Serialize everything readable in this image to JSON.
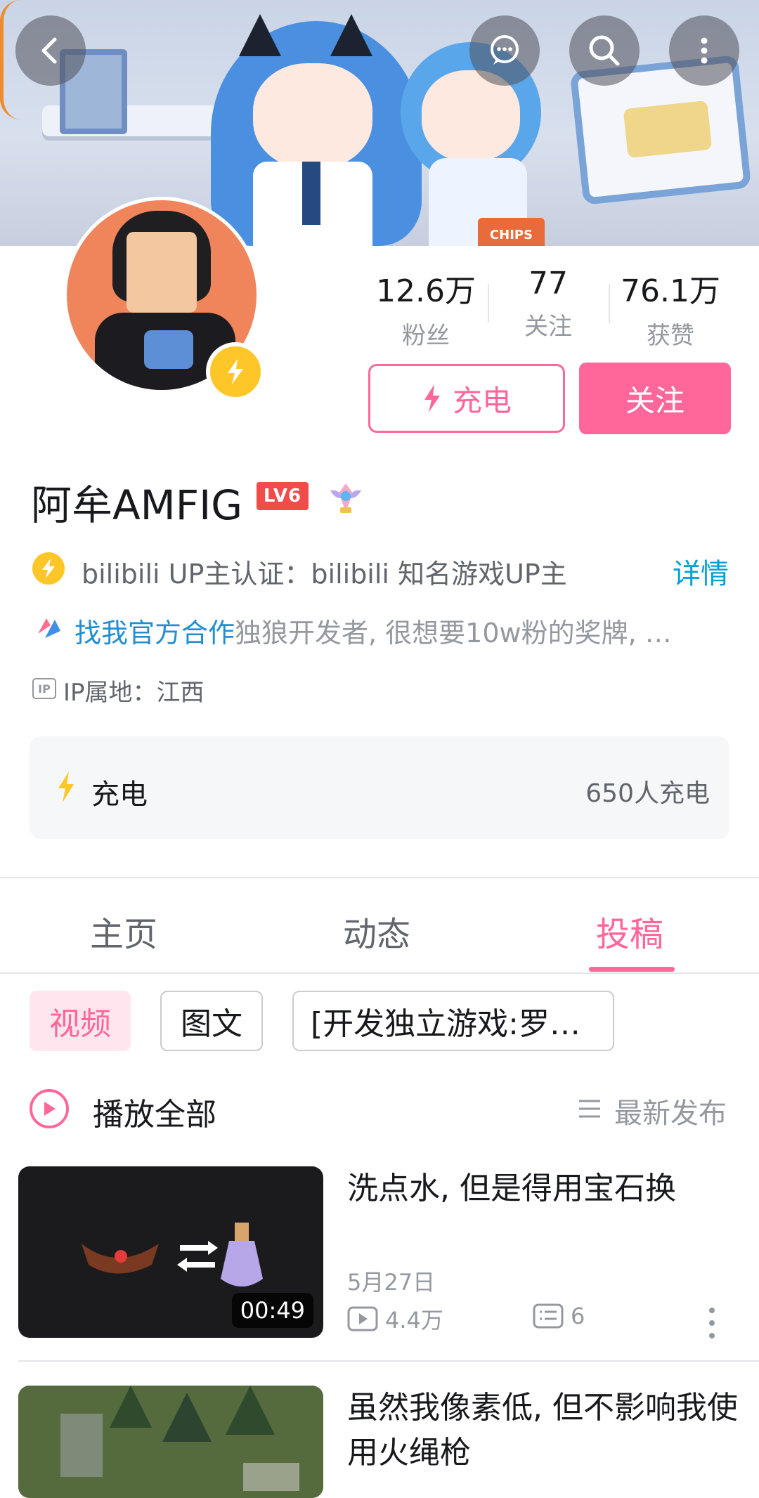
{
  "profile": {
    "name": "阿牟AMFIG",
    "level": "LV6",
    "verification": "bilibili UP主认证：bilibili 知名游戏UP主",
    "detail_link": "详情",
    "coop_link": "找我官方合作",
    "bio": "独狼开发者, 很想要10w粉的奖牌, …",
    "ip_location": "IP属地：江西"
  },
  "stats": [
    {
      "value": "12.6万",
      "label": "粉丝"
    },
    {
      "value": "77",
      "label": "关注"
    },
    {
      "value": "76.1万",
      "label": "获赞"
    }
  ],
  "actions": {
    "charge": "充电",
    "follow": "关注"
  },
  "charge_card": {
    "title": "充电",
    "count": "650人充电"
  },
  "tabs": [
    "主页",
    "动态",
    "投稿"
  ],
  "active_tab": "投稿",
  "filters": [
    "视频",
    "图文",
    "[开发独立游戏:罗…"
  ],
  "play_all": "播放全部",
  "sort": "最新发布",
  "banner_text": {
    "chips": "CHIPS"
  },
  "videos": [
    {
      "title": "洗点水, 但是得用宝石换",
      "duration": "00:49",
      "date": "5月27日",
      "views": "4.4万",
      "comments": "6"
    },
    {
      "title": "虽然我像素低, 但不影响我使用火绳枪"
    }
  ],
  "colors": {
    "accent": "#ff6699",
    "link": "#00a1d6",
    "charge": "#ffc629"
  },
  "icons": [
    "back-icon",
    "message-icon",
    "search-icon",
    "more-vertical-icon",
    "lightning-icon",
    "play-icon",
    "sort-icon"
  ]
}
